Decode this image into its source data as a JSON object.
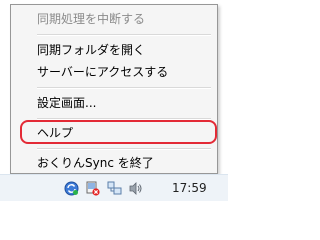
{
  "context_menu": {
    "items": [
      {
        "label": "同期処理を中断する",
        "enabled": false
      },
      {
        "label": "同期フォルダを開く",
        "enabled": true
      },
      {
        "label": "サーバーにアクセスする",
        "enabled": true
      },
      {
        "label": "設定画面...",
        "enabled": true
      },
      {
        "label": "ヘルプ",
        "enabled": true,
        "highlighted": true
      },
      {
        "label": "おくりんSync を終了",
        "enabled": true
      }
    ]
  },
  "taskbar": {
    "tray_icons": [
      "okurin-sync-icon",
      "network-error-icon",
      "network-icon",
      "volume-icon"
    ],
    "clock": "17:59"
  },
  "colors": {
    "highlight_border": "#e32a36",
    "menu_background": "#f5f5f5"
  }
}
